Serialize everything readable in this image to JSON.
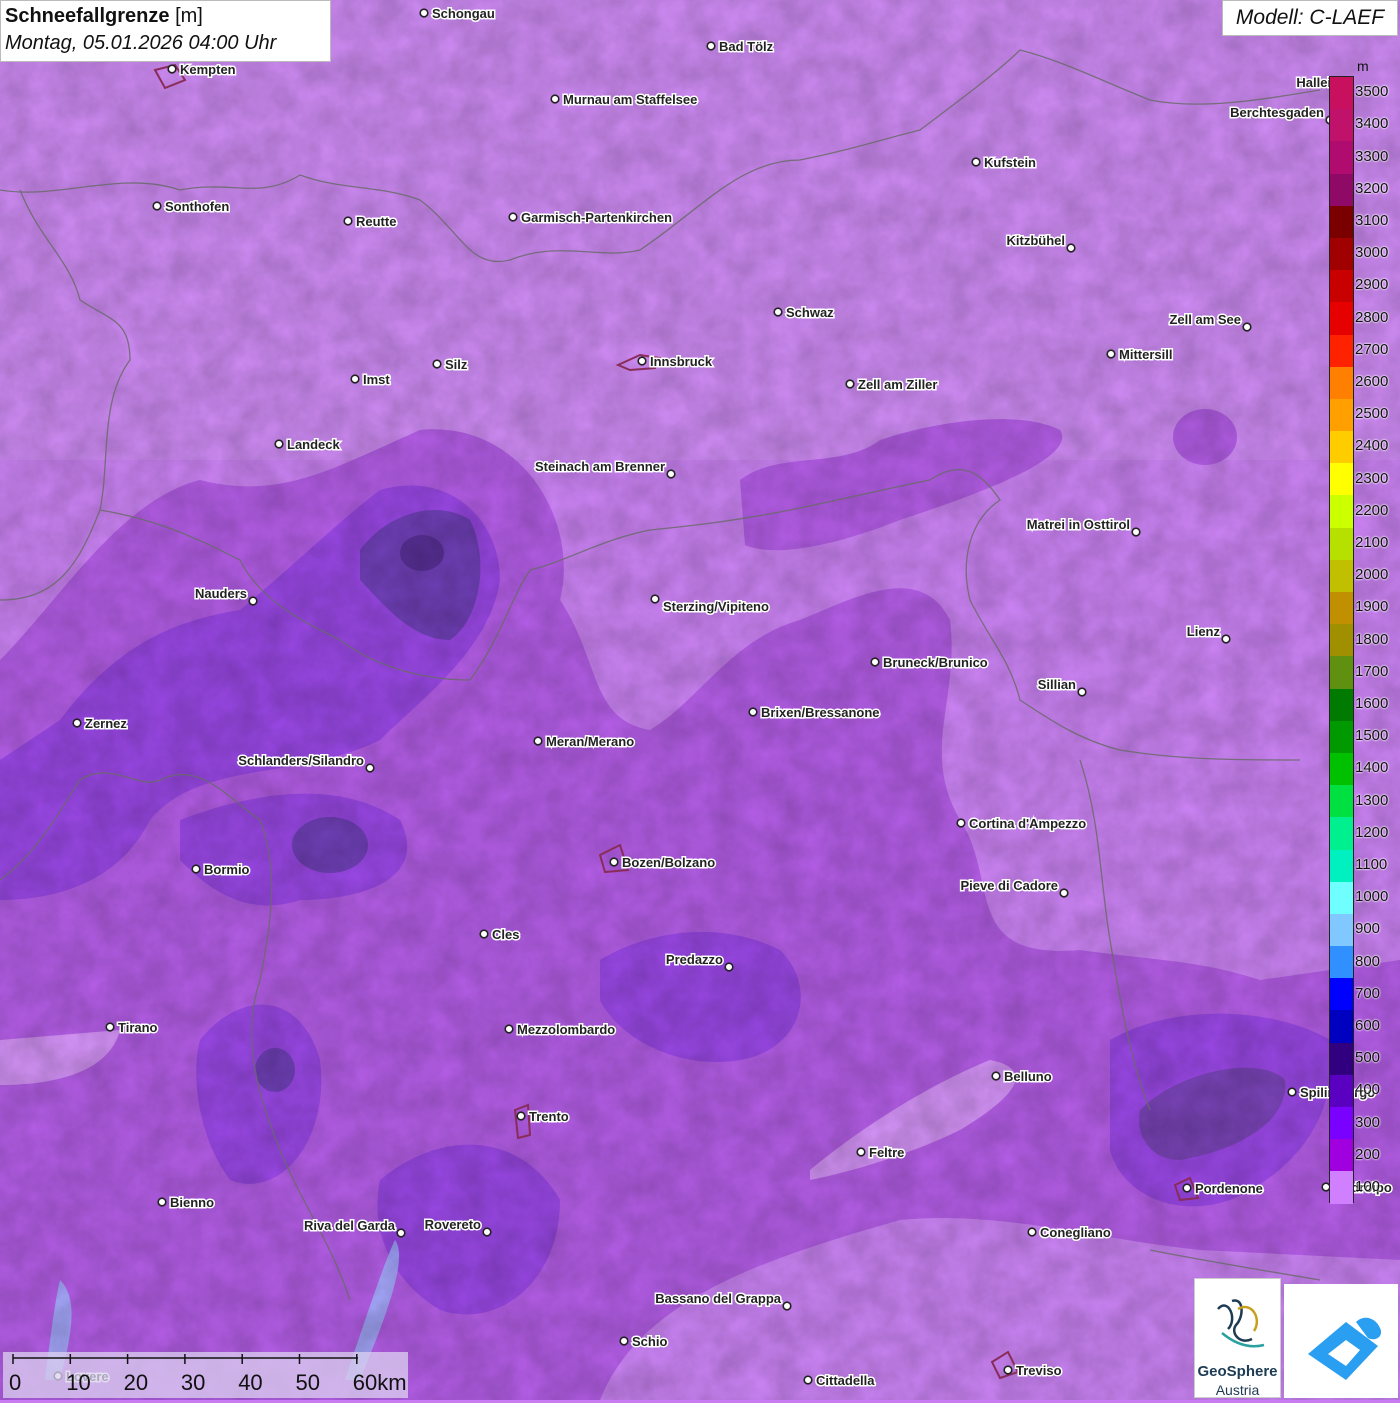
{
  "title": {
    "main": "Schneefallgrenze",
    "unit": "[m]",
    "datetime": "Montag, 05.01.2026 04:00 Uhr"
  },
  "model": "Modell: C-LAEF",
  "legend": {
    "unit": "m",
    "levels": [
      {
        "label": "3500",
        "color": "#c8105e"
      },
      {
        "label": "3400",
        "color": "#c0126a"
      },
      {
        "label": "3300",
        "color": "#b00c70"
      },
      {
        "label": "3200",
        "color": "#8e0a66"
      },
      {
        "label": "3100",
        "color": "#7a0000"
      },
      {
        "label": "3000",
        "color": "#a00000"
      },
      {
        "label": "2900",
        "color": "#c80000"
      },
      {
        "label": "2800",
        "color": "#e60000"
      },
      {
        "label": "2700",
        "color": "#ff2200"
      },
      {
        "label": "2600",
        "color": "#ff7f00"
      },
      {
        "label": "2500",
        "color": "#ff9f00"
      },
      {
        "label": "2400",
        "color": "#ffcc00"
      },
      {
        "label": "2300",
        "color": "#ffff00"
      },
      {
        "label": "2200",
        "color": "#ccff00"
      },
      {
        "label": "2100",
        "color": "#b5e000"
      },
      {
        "label": "2000",
        "color": "#c0c000"
      },
      {
        "label": "1900",
        "color": "#c09000"
      },
      {
        "label": "1800",
        "color": "#a09000"
      },
      {
        "label": "1700",
        "color": "#609010"
      },
      {
        "label": "1600",
        "color": "#007a00"
      },
      {
        "label": "1500",
        "color": "#009a00"
      },
      {
        "label": "1400",
        "color": "#00c000"
      },
      {
        "label": "1300",
        "color": "#00e040"
      },
      {
        "label": "1200",
        "color": "#00f090"
      },
      {
        "label": "1100",
        "color": "#00f0c0"
      },
      {
        "label": "1000",
        "color": "#70ffff"
      },
      {
        "label": "900",
        "color": "#80c8ff"
      },
      {
        "label": "800",
        "color": "#3090ff"
      },
      {
        "label": "700",
        "color": "#0000ff"
      },
      {
        "label": "600",
        "color": "#0000c0"
      },
      {
        "label": "500",
        "color": "#300080"
      },
      {
        "label": "400",
        "color": "#5a00c0"
      },
      {
        "label": "300",
        "color": "#7a00ff"
      },
      {
        "label": "200",
        "color": "#a000e0"
      },
      {
        "label": "100",
        "color": "#d080ff"
      }
    ]
  },
  "scale_bar": {
    "labels": [
      "0",
      "10",
      "20",
      "30",
      "40",
      "50",
      "60km"
    ]
  },
  "cities": [
    {
      "name": "Schongau"
    },
    {
      "name": "Bad Tölz"
    },
    {
      "name": "Kempten"
    },
    {
      "name": "Murnau am Staffelsee"
    },
    {
      "name": "Berchtesgaden"
    },
    {
      "name": "Kufstein"
    },
    {
      "name": "Sonthofen"
    },
    {
      "name": "Reutte"
    },
    {
      "name": "Garmisch-Partenkirchen"
    },
    {
      "name": "Kitzbühel"
    },
    {
      "name": "Schwaz"
    },
    {
      "name": "Zell am See"
    },
    {
      "name": "Innsbruck"
    },
    {
      "name": "Mittersill"
    },
    {
      "name": "Imst"
    },
    {
      "name": "Silz"
    },
    {
      "name": "Zell am Ziller"
    },
    {
      "name": "Landeck"
    },
    {
      "name": "Steinach am Brenner"
    },
    {
      "name": "Matrei in Osttirol"
    },
    {
      "name": "Nauders"
    },
    {
      "name": "Sterzing/Vipiteno"
    },
    {
      "name": "Lienz"
    },
    {
      "name": "Bruneck/Brunico"
    },
    {
      "name": "Sillian"
    },
    {
      "name": "Zernez"
    },
    {
      "name": "Brixen/Bressanone"
    },
    {
      "name": "Meran/Merano"
    },
    {
      "name": "Schlanders/Silandro"
    },
    {
      "name": "Cortina d'Ampezzo"
    },
    {
      "name": "Bozen/Bolzano"
    },
    {
      "name": "Bormio"
    },
    {
      "name": "Pieve di Cadore"
    },
    {
      "name": "Cles"
    },
    {
      "name": "Predazzo"
    },
    {
      "name": "Tirano"
    },
    {
      "name": "Mezzolombardo"
    },
    {
      "name": "Belluno"
    },
    {
      "name": "Spilimbergo"
    },
    {
      "name": "Trento"
    },
    {
      "name": "Feltre"
    },
    {
      "name": "Pordenone"
    },
    {
      "name": "Codroipo"
    },
    {
      "name": "Bienno"
    },
    {
      "name": "Riva del Garda"
    },
    {
      "name": "Rovereto"
    },
    {
      "name": "Conegliano"
    },
    {
      "name": "Bassano del Grappa"
    },
    {
      "name": "Schio"
    },
    {
      "name": "Treviso"
    },
    {
      "name": "Cittadella"
    },
    {
      "name": "Lovere"
    },
    {
      "name": "Hallein"
    }
  ],
  "logos": {
    "geosphere_line1": "GeoSphere",
    "geosphere_line2": "Austria"
  },
  "colors": {
    "map_light": "#cf86f7",
    "map_mid": "#b45ae8",
    "map_dark": "#8a3ae0",
    "map_darkest": "#6a3aa8"
  }
}
